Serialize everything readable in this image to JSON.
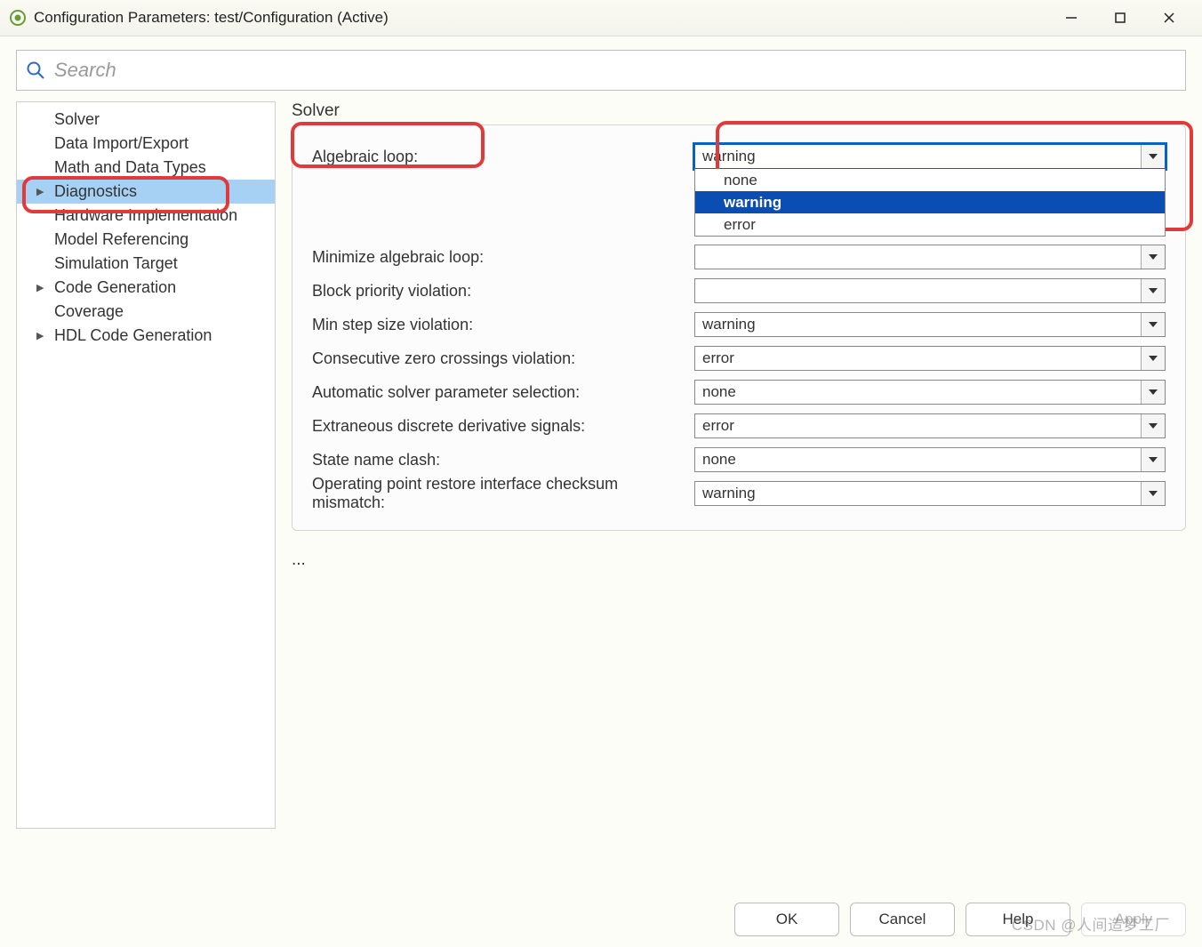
{
  "window": {
    "title": "Configuration Parameters: test/Configuration (Active)"
  },
  "search": {
    "placeholder": "Search"
  },
  "sidebar": {
    "items": [
      {
        "label": "Solver",
        "indent": true,
        "expandable": false,
        "selected": false
      },
      {
        "label": "Data Import/Export",
        "indent": true,
        "expandable": false,
        "selected": false
      },
      {
        "label": "Math and Data Types",
        "indent": true,
        "expandable": false,
        "selected": false
      },
      {
        "label": "Diagnostics",
        "indent": true,
        "expandable": true,
        "selected": true
      },
      {
        "label": "Hardware Implementation",
        "indent": true,
        "expandable": false,
        "selected": false
      },
      {
        "label": "Model Referencing",
        "indent": true,
        "expandable": false,
        "selected": false
      },
      {
        "label": "Simulation Target",
        "indent": true,
        "expandable": false,
        "selected": false
      },
      {
        "label": "Code Generation",
        "indent": true,
        "expandable": true,
        "selected": false
      },
      {
        "label": "Coverage",
        "indent": true,
        "expandable": false,
        "selected": false
      },
      {
        "label": "HDL Code Generation",
        "indent": true,
        "expandable": true,
        "selected": false
      }
    ]
  },
  "main": {
    "section_title": "Solver",
    "rows": [
      {
        "label": "Algebraic loop:",
        "value": "warning",
        "open": true,
        "options": [
          "none",
          "warning",
          "error"
        ],
        "selected_option": "warning"
      },
      {
        "label": "Minimize algebraic loop:",
        "value": "",
        "open": false
      },
      {
        "label": "Block priority violation:",
        "value": "",
        "open": false
      },
      {
        "label": "Min step size violation:",
        "value": "warning",
        "open": false
      },
      {
        "label": "Consecutive zero crossings violation:",
        "value": "error",
        "open": false
      },
      {
        "label": "Automatic solver parameter selection:",
        "value": "none",
        "open": false
      },
      {
        "label": "Extraneous discrete derivative signals:",
        "value": "error",
        "open": false
      },
      {
        "label": "State name clash:",
        "value": "none",
        "open": false
      },
      {
        "label": "Operating point restore interface checksum mismatch:",
        "value": "warning",
        "open": false
      }
    ],
    "ellipsis": "..."
  },
  "footer": {
    "ok": "OK",
    "cancel": "Cancel",
    "help": "Help",
    "apply": "Apply"
  },
  "watermark": "CSDN @人间造梦工厂"
}
